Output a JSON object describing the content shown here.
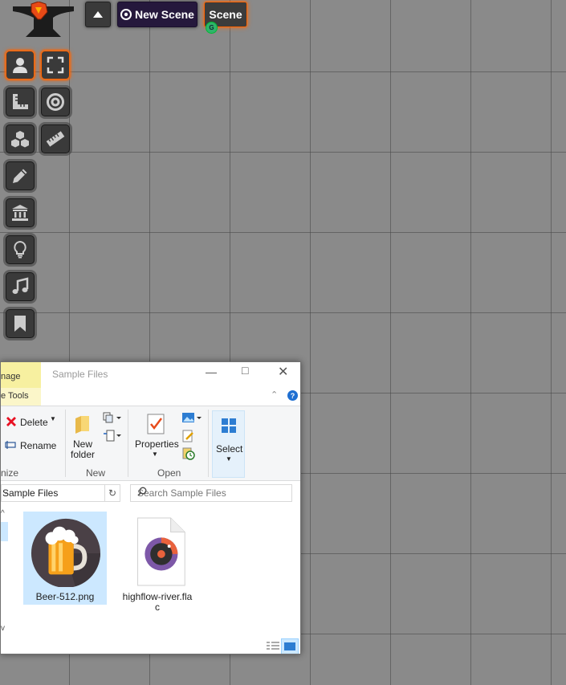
{
  "topbar": {
    "collapse_icon": "caret-up-icon",
    "new_scene_label": "New Scene",
    "scene_label": "Scene",
    "gm_badge": "G",
    "accent": "#ff6400"
  },
  "toolbar": {
    "tools": [
      "token-controls",
      "tile-controls",
      "measurement-ruler",
      "target",
      "dice-stack",
      "ruler",
      "draw-pencil",
      "journal-building",
      "lightbulb",
      "music-note",
      "bookmark"
    ]
  },
  "explorer": {
    "context_tab": "nage",
    "context_tab2": "e Tools",
    "title": "Sample Files",
    "ribbon": {
      "delete_label": "Delete",
      "rename_label": "Rename",
      "new_folder_label": "New\nfolder",
      "new_folder_line1": "New",
      "new_folder_line2": "folder",
      "properties_label": "Properties",
      "select_label": "Select",
      "group_organize": "nize",
      "group_new": "New",
      "group_open": "Open"
    },
    "address_text": "Sample Files",
    "search_placeholder": "Search Sample Files",
    "files": [
      {
        "name": "Beer-512.png",
        "selected": true
      },
      {
        "name_line1": "highflow-river.fla",
        "name_line2": "c",
        "selected": false
      }
    ],
    "scroll_up": "^",
    "scroll_down": "v",
    "help": "?"
  }
}
